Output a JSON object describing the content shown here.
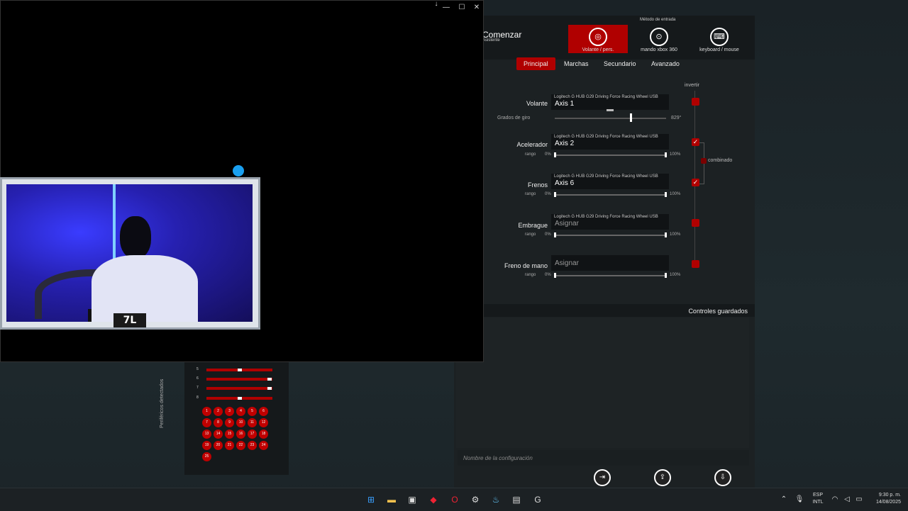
{
  "config": {
    "input_method_label": "Método de entrada",
    "start_title": "Comenzar",
    "start_subtitle": "Asistente",
    "modes": [
      {
        "label": "Volante / pers.",
        "icon": "steering-wheel-icon",
        "active": true
      },
      {
        "label": "mando xbox 360",
        "icon": "gamepad-icon",
        "active": false
      },
      {
        "label": "keyboard / mouse",
        "icon": "keyboard-mouse-icon",
        "active": false
      }
    ],
    "tabs": [
      "Principal",
      "Marchas",
      "Secundario",
      "Avanzado"
    ],
    "active_tab": "Principal",
    "invert_label": "invertir",
    "combined_label": "combinado",
    "rotation_label": "Grados de giro",
    "rotation_value": "829°",
    "range_label": "rango",
    "range_min": "0%",
    "range_max": "100%",
    "axes": [
      {
        "name": "Volante",
        "device": "Logitech G HUB G29 Driving Force Racing Wheel USB",
        "value": "Axis 1",
        "checked": false
      },
      {
        "name": "Acelerador",
        "device": "Logitech G HUB G29 Driving Force Racing Wheel USB",
        "value": "Axis 2",
        "checked": true
      },
      {
        "name": "Frenos",
        "device": "Logitech G HUB G29 Driving Force Racing Wheel USB",
        "value": "Axis 6",
        "checked": true
      },
      {
        "name": "Embrague",
        "device": "Logitech G HUB G29 Driving Force Racing Wheel USB",
        "value": "Asignar",
        "checked": false
      },
      {
        "name": "Freno de mano",
        "device": "",
        "value": "Asignar",
        "checked": false
      }
    ],
    "saved_controls_label": "Controles guardados",
    "config_name_placeholder": "Nombre de la configuración"
  },
  "peripherals": {
    "title": "Periféricos detectados",
    "axis_numbers": [
      "5",
      "6",
      "7",
      "8"
    ],
    "axis_levels": [
      0.5,
      0.95,
      0.95,
      0.5
    ],
    "buttons": [
      "1",
      "2",
      "3",
      "4",
      "5",
      "6",
      "7",
      "8",
      "9",
      "10",
      "11",
      "12",
      "13",
      "14",
      "15",
      "16",
      "17",
      "18",
      "19",
      "20",
      "21",
      "22",
      "23",
      "24",
      "25"
    ]
  },
  "overlay": {
    "logo_text": "7L"
  },
  "taskbar": {
    "language": "ESP",
    "layout": "INTL",
    "time": "9:30 p. m.",
    "date": "14/08/2025"
  },
  "colors": {
    "accent_red": "#b00000",
    "webcam_blue": "#2a2ad8"
  }
}
